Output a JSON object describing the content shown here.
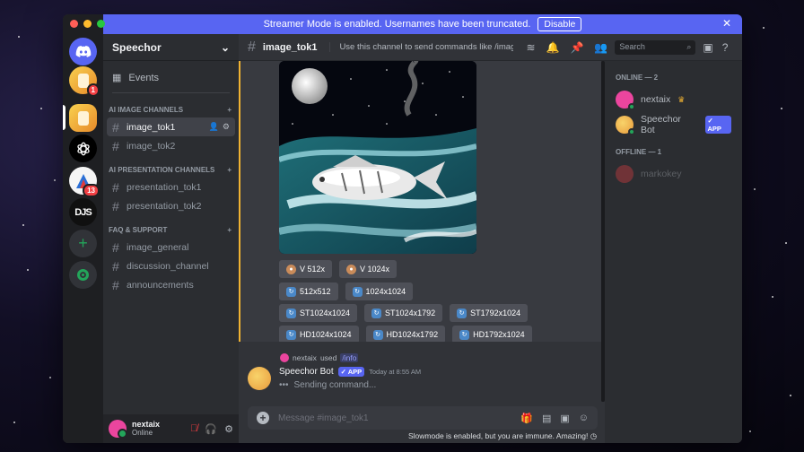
{
  "banner": {
    "text": "Streamer Mode is enabled. Usernames have been truncated.",
    "button": "Disable",
    "close": "✕"
  },
  "servers": [
    {
      "name": "server-1",
      "badge": "1"
    },
    {
      "name": "server-2",
      "badge": ""
    },
    {
      "name": "openai",
      "badge": ""
    },
    {
      "name": "server-4",
      "badge": "13"
    },
    {
      "name": "DJS",
      "label": "DJS",
      "badge": ""
    }
  ],
  "sidebar": {
    "server_name": "Speechor",
    "events_label": "Events",
    "categories": [
      {
        "name": "AI IMAGE CHANNELS",
        "channels": [
          "image_tok1",
          "image_tok2"
        ]
      },
      {
        "name": "AI PRESENTATION CHANNELS",
        "channels": [
          "presentation_tok1",
          "presentation_tok2"
        ]
      },
      {
        "name": "FAQ & SUPPORT",
        "channels": [
          "image_general",
          "discussion_channel",
          "announcements"
        ]
      }
    ],
    "active_channel": "image_tok1"
  },
  "user": {
    "name": "nextaix",
    "status": "Online"
  },
  "header": {
    "channel": "image_tok1",
    "topic": "Use this channel to send commands like /imagine to...",
    "search_placeholder": "Search"
  },
  "buttons": {
    "row1": [
      "V 512x",
      "V 1024x"
    ],
    "row2": [
      "512x512",
      "1024x1024"
    ],
    "row3": [
      "ST1024x1024",
      "ST1024x1792",
      "ST1792x1024"
    ],
    "row4": [
      "HD1024x1024",
      "HD1024x1792",
      "HD1792x1024"
    ]
  },
  "reply": {
    "user": "nextaix",
    "used": "used",
    "command": "/info"
  },
  "bot_message": {
    "author": "Speechor Bot",
    "badge": "APP",
    "time": "Today at 8:55 AM",
    "text": "Sending command..."
  },
  "composer": {
    "placeholder": "Message #image_tok1"
  },
  "slowmode": "Slowmode is enabled, but you are immune. Amazing!",
  "members": {
    "online_header": "ONLINE — 2",
    "online": [
      {
        "name": "nextaix",
        "color": "#eb459e"
      },
      {
        "name": "Speechor Bot",
        "badge": "APP",
        "color": "#f0b232"
      }
    ],
    "offline_header": "OFFLINE — 1",
    "offline": [
      {
        "name": "markokey",
        "color": "#f23f43"
      }
    ]
  }
}
